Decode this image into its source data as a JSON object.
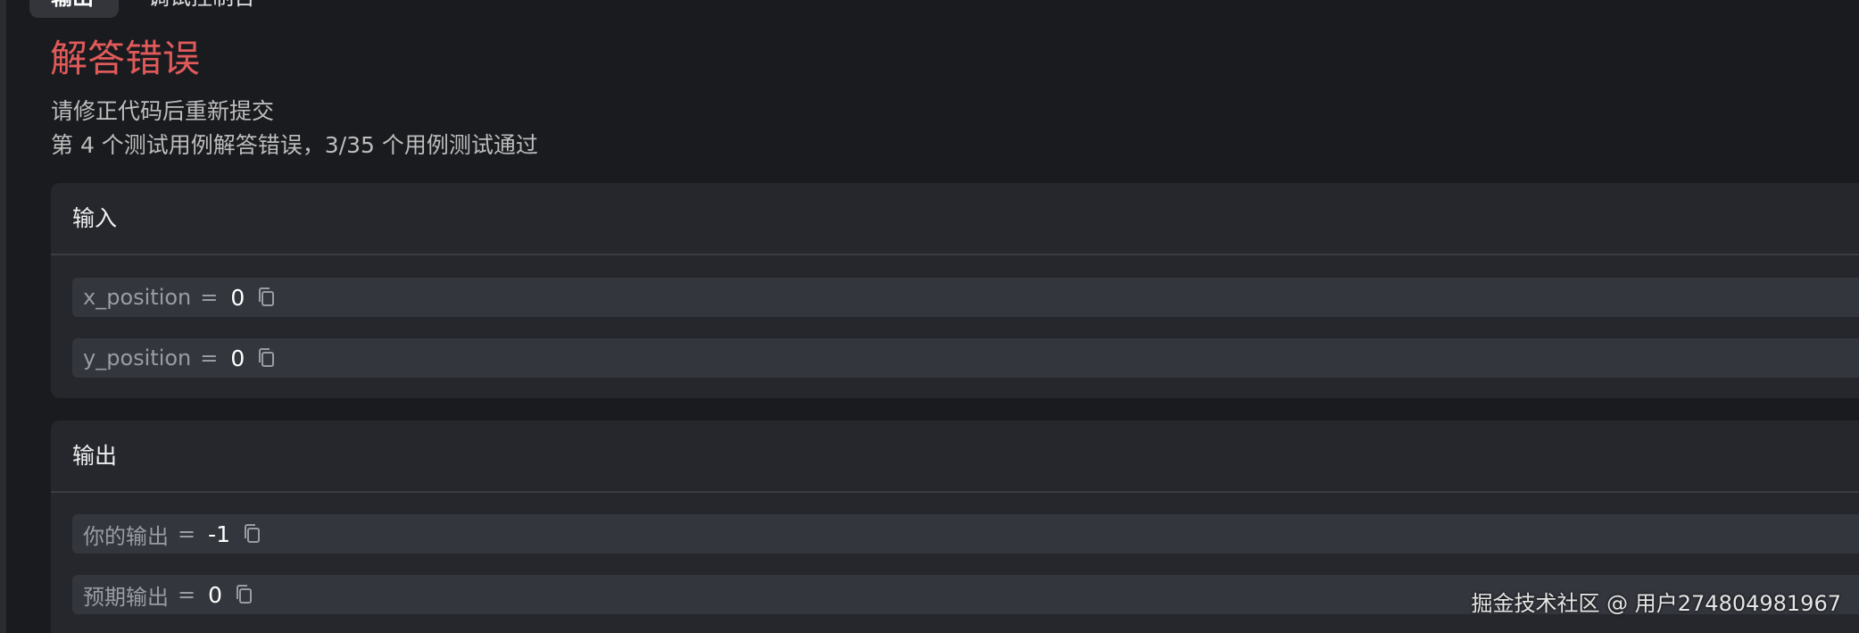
{
  "tabs": [
    {
      "label": "输出"
    },
    {
      "label": "调试控制台"
    }
  ],
  "result": {
    "title": "解答错误",
    "message": "请修正代码后重新提交",
    "detail": "第 4 个测试用例解答错误，3/35 个用例测试通过"
  },
  "input_panel": {
    "header": "输入",
    "rows": [
      {
        "name": "x_position",
        "eq": "=",
        "value": "0"
      },
      {
        "name": "y_position",
        "eq": "=",
        "value": "0"
      }
    ]
  },
  "output_panel": {
    "header": "输出",
    "rows": [
      {
        "name": "你的输出",
        "eq": "=",
        "value": "-1"
      },
      {
        "name": "预期输出",
        "eq": "=",
        "value": "0"
      }
    ]
  },
  "watermark": "掘金技术社区 @ 用户274804981967",
  "colors": {
    "background": "#1a1b1f",
    "panel": "#25272c",
    "row": "#33363d",
    "error_title": "#e05a5a"
  },
  "icons": {
    "copy": "copy-icon"
  }
}
